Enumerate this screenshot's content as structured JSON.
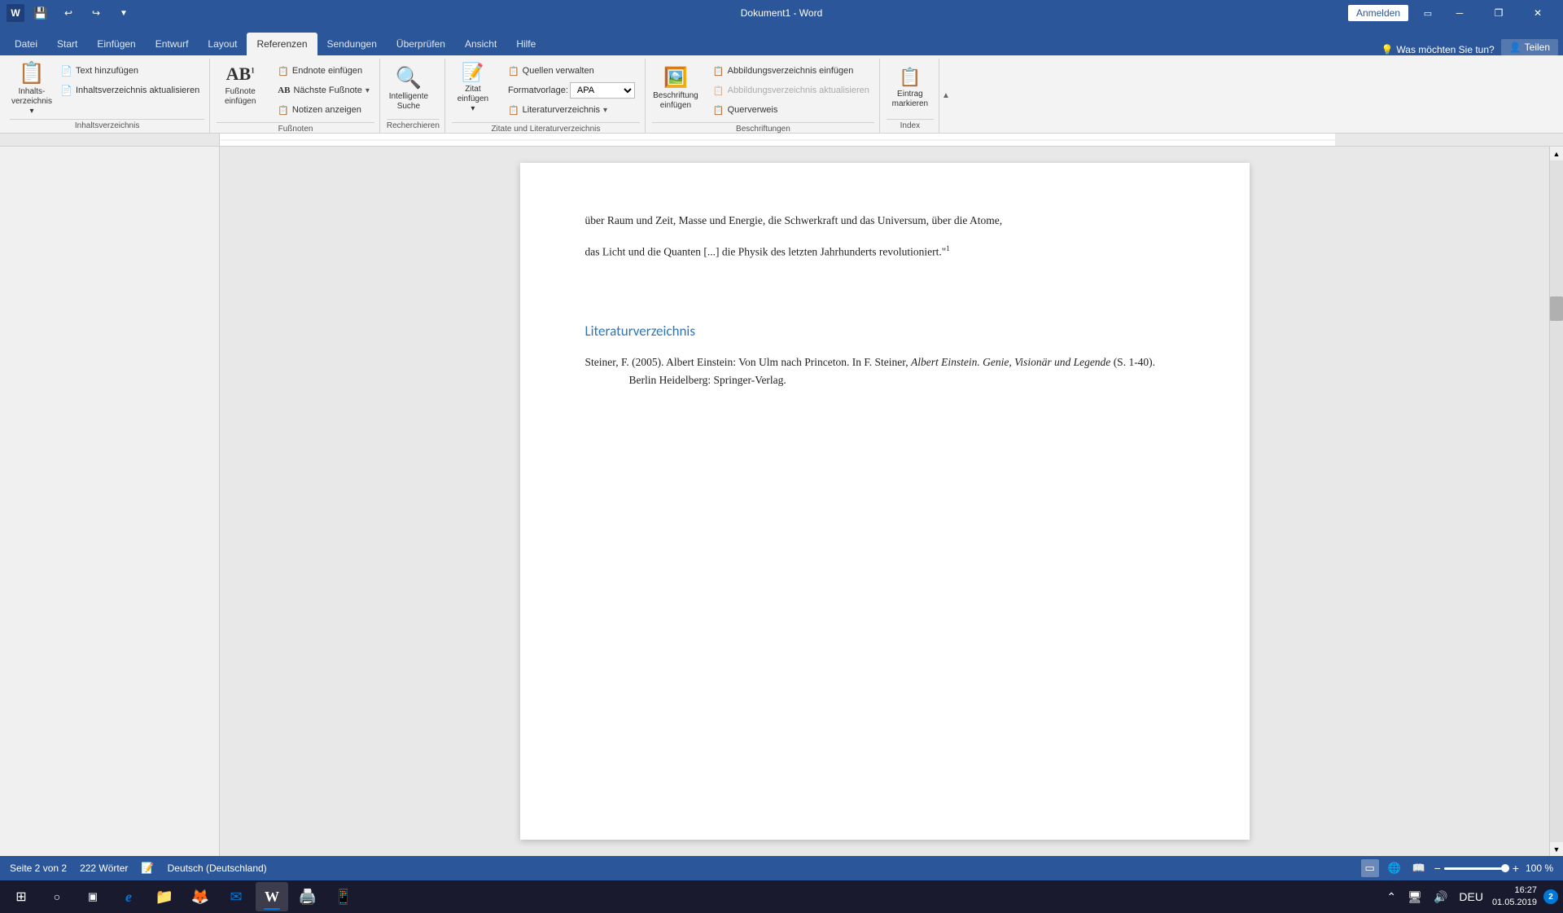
{
  "titlebar": {
    "title": "Dokument1 - Word",
    "app_name": "Word",
    "signin_label": "Anmelden",
    "minimize_symbol": "─",
    "restore_symbol": "❐",
    "close_symbol": "✕",
    "quick_save": "💾",
    "quick_undo": "↩",
    "quick_redo": "↪",
    "quick_custom": "▼"
  },
  "tabs": [
    {
      "id": "datei",
      "label": "Datei",
      "active": false
    },
    {
      "id": "start",
      "label": "Start",
      "active": false
    },
    {
      "id": "einfuegen",
      "label": "Einfügen",
      "active": false
    },
    {
      "id": "entwurf",
      "label": "Entwurf",
      "active": false
    },
    {
      "id": "layout",
      "label": "Layout",
      "active": false
    },
    {
      "id": "referenzen",
      "label": "Referenzen",
      "active": true
    },
    {
      "id": "sendungen",
      "label": "Sendungen",
      "active": false
    },
    {
      "id": "ueberpruefen",
      "label": "Überprüfen",
      "active": false
    },
    {
      "id": "ansicht",
      "label": "Ansicht",
      "active": false
    },
    {
      "id": "hilfe",
      "label": "Hilfe",
      "active": false
    }
  ],
  "search_placeholder": "Was möchten Sie tun?",
  "share_label": "Teilen",
  "ribbon": {
    "groups": [
      {
        "id": "inhaltsverzeichnis",
        "label": "Inhaltsverzeichnis",
        "buttons": [
          {
            "id": "inhaltsverzeichnis",
            "label": "Inhalts-\nverzeichnis",
            "icon": "📋",
            "type": "large"
          },
          {
            "id": "text-hinzufuegen",
            "label": "Text hinzufügen",
            "icon": "📄",
            "type": "small"
          },
          {
            "id": "aktualisieren",
            "label": "Inhaltsverzeichnis aktualisieren",
            "icon": "📄",
            "type": "small"
          }
        ]
      },
      {
        "id": "fussnoten",
        "label": "Fußnoten",
        "buttons": [
          {
            "id": "fussnote-einfuegen",
            "label": "Fußnote\neinfügen",
            "icon": "AB¹",
            "type": "large"
          },
          {
            "id": "naechste-fussnote",
            "label": "Nächste Fußnote",
            "icon": "AB",
            "type": "small"
          },
          {
            "id": "notizen-anzeigen",
            "label": "Notizen anzeigen",
            "icon": "📋",
            "type": "small"
          },
          {
            "id": "endnote-einfuegen",
            "label": "Endnote einfügen",
            "icon": "📋",
            "type": "small"
          }
        ]
      },
      {
        "id": "recherchieren",
        "label": "Recherchieren",
        "buttons": [
          {
            "id": "intelligente-suche",
            "label": "Intelligente\nSuche",
            "icon": "🔍",
            "type": "large"
          }
        ]
      },
      {
        "id": "zitate",
        "label": "Zitate und Literaturverzeichnis",
        "buttons": [
          {
            "id": "zitat-einfuegen",
            "label": "Zitat\neinfügen",
            "icon": "📝",
            "type": "large"
          },
          {
            "id": "quellen-verwalten",
            "label": "Quellen verwalten",
            "icon": "📋",
            "type": "small"
          },
          {
            "id": "formatvorlage",
            "label": "Formatvorlage:",
            "value": "APA",
            "type": "select"
          },
          {
            "id": "literaturverzeichnis",
            "label": "Literaturverzeichnis",
            "icon": "📋",
            "type": "small"
          }
        ]
      },
      {
        "id": "beschriftungen",
        "label": "Beschriftungen",
        "buttons": [
          {
            "id": "beschriftung-einfuegen",
            "label": "Beschriftung\neinfügen",
            "icon": "🖼️",
            "type": "large"
          },
          {
            "id": "abbildungsverzeichnis",
            "label": "Abbildungsverzeichnis einfügen",
            "icon": "📋",
            "type": "small"
          },
          {
            "id": "abbildungsverzeichnis-akt",
            "label": "Abbildungsverzeichnis aktualisieren",
            "icon": "📋",
            "type": "small",
            "disabled": true
          },
          {
            "id": "querverweis",
            "label": "Querverweis",
            "icon": "📋",
            "type": "small"
          }
        ]
      },
      {
        "id": "index",
        "label": "Index",
        "buttons": [
          {
            "id": "eintrag-markieren",
            "label": "Eintrag\nmarkieren",
            "icon": "📋",
            "type": "large"
          }
        ]
      }
    ]
  },
  "document": {
    "intro_text": "über Raum und Zeit, Masse und Energie, die Schwerkraft und das Universum, über die Atome,",
    "quote_text": "das Licht und die Quanten [...] die Physik des letzten Jahrhunderts revolutioniert.\"",
    "footnote_ref": "1",
    "bibliography_heading": "Literaturverzeichnis",
    "bibliography_entry_normal": "Steiner, F. (2005). Albert Einstein: Von Ulm nach Princeton. In F. Steiner,",
    "bibliography_entry_italic": "Albert Einstein. Genie, Visionär und Legende",
    "bibliography_entry_end": "(S. 1-40). Berlin Heidelberg: Springer-Verlag."
  },
  "statusbar": {
    "page_info": "Seite 2 von 2",
    "word_count": "222 Wörter",
    "language": "Deutsch (Deutschland)"
  },
  "zoom": {
    "level": "100 %",
    "minus": "−",
    "plus": "+"
  },
  "taskbar": {
    "time": "16:27",
    "date": "01.05.2019",
    "language": "DEU",
    "notification_count": "2",
    "start_icon": "⊞",
    "search_icon": "○",
    "task_icon": "▣",
    "edge_icon": "e",
    "explorer_icon": "📁",
    "firefox_icon": "🦊",
    "mail_icon": "✉",
    "word_icon": "W",
    "app5_icon": "📰",
    "app6_icon": "📱"
  }
}
